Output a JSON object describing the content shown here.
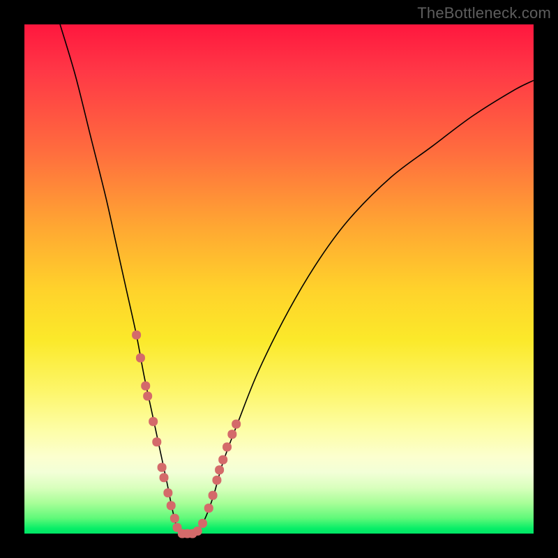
{
  "watermark": "TheBottleneck.com",
  "chart_data": {
    "type": "line",
    "title": "",
    "xlabel": "",
    "ylabel": "",
    "xlim": [
      0,
      100
    ],
    "ylim": [
      0,
      100
    ],
    "grid": false,
    "series": [
      {
        "name": "bottleneck-curve",
        "x": [
          7,
          10,
          13,
          16,
          18,
          20,
          22,
          23.5,
          25,
          26.5,
          28,
          29,
          30,
          31,
          33,
          35,
          37,
          39,
          42,
          46,
          52,
          58,
          64,
          72,
          80,
          88,
          96,
          100
        ],
        "y": [
          100,
          90,
          78,
          66,
          57,
          48,
          39,
          31,
          24,
          17,
          10,
          5,
          1,
          0,
          0,
          2,
          7,
          14,
          22,
          32,
          44,
          54,
          62,
          70,
          76,
          82,
          87,
          89
        ]
      }
    ],
    "markers": {
      "name": "highlight-points",
      "x": [
        22.0,
        22.8,
        23.8,
        24.2,
        25.3,
        26.0,
        27.0,
        27.4,
        28.2,
        28.8,
        29.5,
        30.0,
        31.0,
        32.0,
        33.0,
        34.0,
        35.0,
        36.2,
        37.0,
        37.8,
        38.3,
        39.0,
        39.8,
        40.8,
        41.6
      ],
      "y": [
        39.0,
        34.5,
        29.0,
        27.0,
        22.0,
        18.0,
        13.0,
        11.0,
        8.0,
        5.5,
        3.0,
        1.2,
        0.0,
        0.0,
        0.0,
        0.5,
        2.0,
        5.0,
        7.5,
        10.5,
        12.5,
        14.5,
        17.0,
        19.5,
        21.5
      ]
    },
    "gradient_stops": [
      {
        "pos": 0,
        "color": "#ff173e"
      },
      {
        "pos": 25,
        "color": "#ff6d3e"
      },
      {
        "pos": 52,
        "color": "#ffd22b"
      },
      {
        "pos": 80,
        "color": "#fdfea9"
      },
      {
        "pos": 100,
        "color": "#00e566"
      }
    ]
  }
}
